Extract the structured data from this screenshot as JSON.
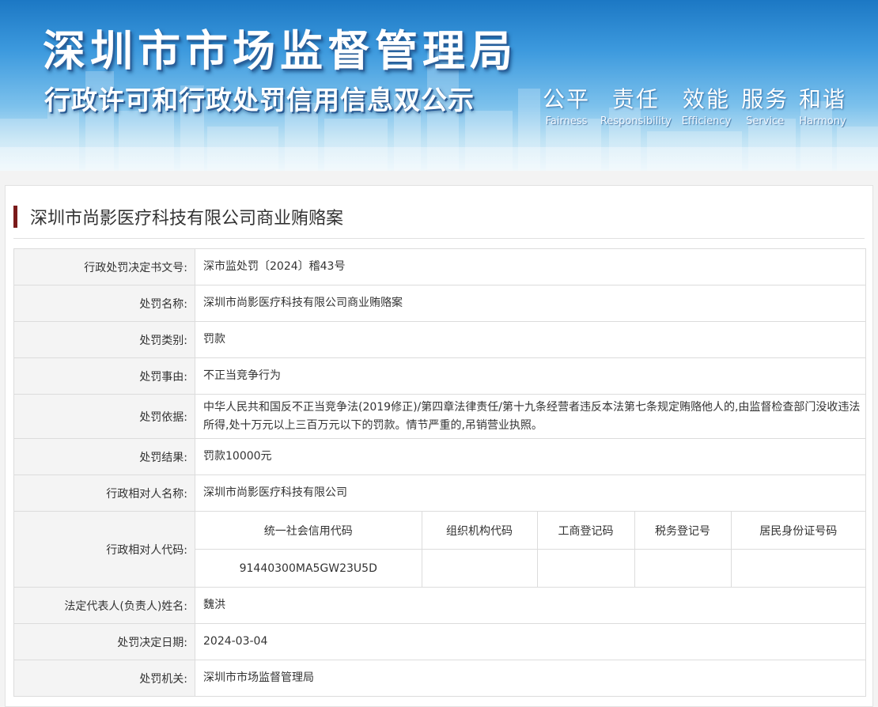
{
  "banner": {
    "title": "深圳市市场监督管理局",
    "subtitle": "行政许可和行政处罚信用信息双公示",
    "motto": [
      {
        "cn": "公平",
        "en": "Fairness"
      },
      {
        "cn": "责任",
        "en": "Responsibility"
      },
      {
        "cn": "效能",
        "en": "Efficiency"
      },
      {
        "cn": "服务",
        "en": "Service"
      },
      {
        "cn": "和谐",
        "en": "Harmony"
      }
    ]
  },
  "case": {
    "title": "深圳市尚影医疗科技有限公司商业贿赂案",
    "rows": {
      "doc_no": {
        "label": "行政处罚决定书文号:",
        "value": "深市监处罚〔2024〕稽43号"
      },
      "name": {
        "label": "处罚名称:",
        "value": "深圳市尚影医疗科技有限公司商业贿赂案"
      },
      "category": {
        "label": "处罚类别:",
        "value": "罚款"
      },
      "reason": {
        "label": "处罚事由:",
        "value": "不正当竞争行为"
      },
      "basis": {
        "label": "处罚依据:",
        "value": "中华人民共和国反不正当竞争法(2019修正)/第四章法律责任/第十九条经营者违反本法第七条规定贿赂他人的,由监督检查部门没收违法所得,处十万元以上三百万元以下的罚款。情节严重的,吊销营业执照。"
      },
      "result": {
        "label": "处罚结果:",
        "value": "罚款10000元"
      },
      "party_name": {
        "label": "行政相对人名称:",
        "value": "深圳市尚影医疗科技有限公司"
      },
      "party_code": {
        "label": "行政相对人代码:",
        "headers": [
          "统一社会信用代码",
          "组织机构代码",
          "工商登记码",
          "税务登记号",
          "居民身份证号码"
        ],
        "values": [
          "91440300MA5GW23U5D",
          "",
          "",
          "",
          ""
        ]
      },
      "legal_rep": {
        "label": "法定代表人(负责人)姓名:",
        "value": "魏洪"
      },
      "date": {
        "label": "处罚决定日期:",
        "value": "2024-03-04"
      },
      "authority": {
        "label": "处罚机关:",
        "value": "深圳市市场监督管理局"
      }
    }
  }
}
